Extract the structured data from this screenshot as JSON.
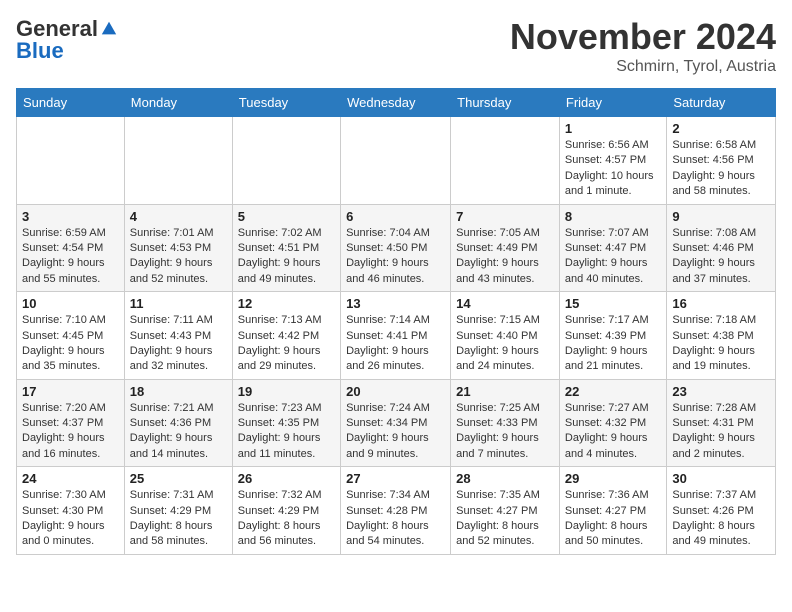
{
  "logo": {
    "general": "General",
    "blue": "Blue"
  },
  "header": {
    "month": "November 2024",
    "location": "Schmirn, Tyrol, Austria"
  },
  "weekdays": [
    "Sunday",
    "Monday",
    "Tuesday",
    "Wednesday",
    "Thursday",
    "Friday",
    "Saturday"
  ],
  "weeks": [
    [
      {
        "day": "",
        "info": ""
      },
      {
        "day": "",
        "info": ""
      },
      {
        "day": "",
        "info": ""
      },
      {
        "day": "",
        "info": ""
      },
      {
        "day": "",
        "info": ""
      },
      {
        "day": "1",
        "info": "Sunrise: 6:56 AM\nSunset: 4:57 PM\nDaylight: 10 hours and 1 minute."
      },
      {
        "day": "2",
        "info": "Sunrise: 6:58 AM\nSunset: 4:56 PM\nDaylight: 9 hours and 58 minutes."
      }
    ],
    [
      {
        "day": "3",
        "info": "Sunrise: 6:59 AM\nSunset: 4:54 PM\nDaylight: 9 hours and 55 minutes."
      },
      {
        "day": "4",
        "info": "Sunrise: 7:01 AM\nSunset: 4:53 PM\nDaylight: 9 hours and 52 minutes."
      },
      {
        "day": "5",
        "info": "Sunrise: 7:02 AM\nSunset: 4:51 PM\nDaylight: 9 hours and 49 minutes."
      },
      {
        "day": "6",
        "info": "Sunrise: 7:04 AM\nSunset: 4:50 PM\nDaylight: 9 hours and 46 minutes."
      },
      {
        "day": "7",
        "info": "Sunrise: 7:05 AM\nSunset: 4:49 PM\nDaylight: 9 hours and 43 minutes."
      },
      {
        "day": "8",
        "info": "Sunrise: 7:07 AM\nSunset: 4:47 PM\nDaylight: 9 hours and 40 minutes."
      },
      {
        "day": "9",
        "info": "Sunrise: 7:08 AM\nSunset: 4:46 PM\nDaylight: 9 hours and 37 minutes."
      }
    ],
    [
      {
        "day": "10",
        "info": "Sunrise: 7:10 AM\nSunset: 4:45 PM\nDaylight: 9 hours and 35 minutes."
      },
      {
        "day": "11",
        "info": "Sunrise: 7:11 AM\nSunset: 4:43 PM\nDaylight: 9 hours and 32 minutes."
      },
      {
        "day": "12",
        "info": "Sunrise: 7:13 AM\nSunset: 4:42 PM\nDaylight: 9 hours and 29 minutes."
      },
      {
        "day": "13",
        "info": "Sunrise: 7:14 AM\nSunset: 4:41 PM\nDaylight: 9 hours and 26 minutes."
      },
      {
        "day": "14",
        "info": "Sunrise: 7:15 AM\nSunset: 4:40 PM\nDaylight: 9 hours and 24 minutes."
      },
      {
        "day": "15",
        "info": "Sunrise: 7:17 AM\nSunset: 4:39 PM\nDaylight: 9 hours and 21 minutes."
      },
      {
        "day": "16",
        "info": "Sunrise: 7:18 AM\nSunset: 4:38 PM\nDaylight: 9 hours and 19 minutes."
      }
    ],
    [
      {
        "day": "17",
        "info": "Sunrise: 7:20 AM\nSunset: 4:37 PM\nDaylight: 9 hours and 16 minutes."
      },
      {
        "day": "18",
        "info": "Sunrise: 7:21 AM\nSunset: 4:36 PM\nDaylight: 9 hours and 14 minutes."
      },
      {
        "day": "19",
        "info": "Sunrise: 7:23 AM\nSunset: 4:35 PM\nDaylight: 9 hours and 11 minutes."
      },
      {
        "day": "20",
        "info": "Sunrise: 7:24 AM\nSunset: 4:34 PM\nDaylight: 9 hours and 9 minutes."
      },
      {
        "day": "21",
        "info": "Sunrise: 7:25 AM\nSunset: 4:33 PM\nDaylight: 9 hours and 7 minutes."
      },
      {
        "day": "22",
        "info": "Sunrise: 7:27 AM\nSunset: 4:32 PM\nDaylight: 9 hours and 4 minutes."
      },
      {
        "day": "23",
        "info": "Sunrise: 7:28 AM\nSunset: 4:31 PM\nDaylight: 9 hours and 2 minutes."
      }
    ],
    [
      {
        "day": "24",
        "info": "Sunrise: 7:30 AM\nSunset: 4:30 PM\nDaylight: 9 hours and 0 minutes."
      },
      {
        "day": "25",
        "info": "Sunrise: 7:31 AM\nSunset: 4:29 PM\nDaylight: 8 hours and 58 minutes."
      },
      {
        "day": "26",
        "info": "Sunrise: 7:32 AM\nSunset: 4:29 PM\nDaylight: 8 hours and 56 minutes."
      },
      {
        "day": "27",
        "info": "Sunrise: 7:34 AM\nSunset: 4:28 PM\nDaylight: 8 hours and 54 minutes."
      },
      {
        "day": "28",
        "info": "Sunrise: 7:35 AM\nSunset: 4:27 PM\nDaylight: 8 hours and 52 minutes."
      },
      {
        "day": "29",
        "info": "Sunrise: 7:36 AM\nSunset: 4:27 PM\nDaylight: 8 hours and 50 minutes."
      },
      {
        "day": "30",
        "info": "Sunrise: 7:37 AM\nSunset: 4:26 PM\nDaylight: 8 hours and 49 minutes."
      }
    ]
  ]
}
